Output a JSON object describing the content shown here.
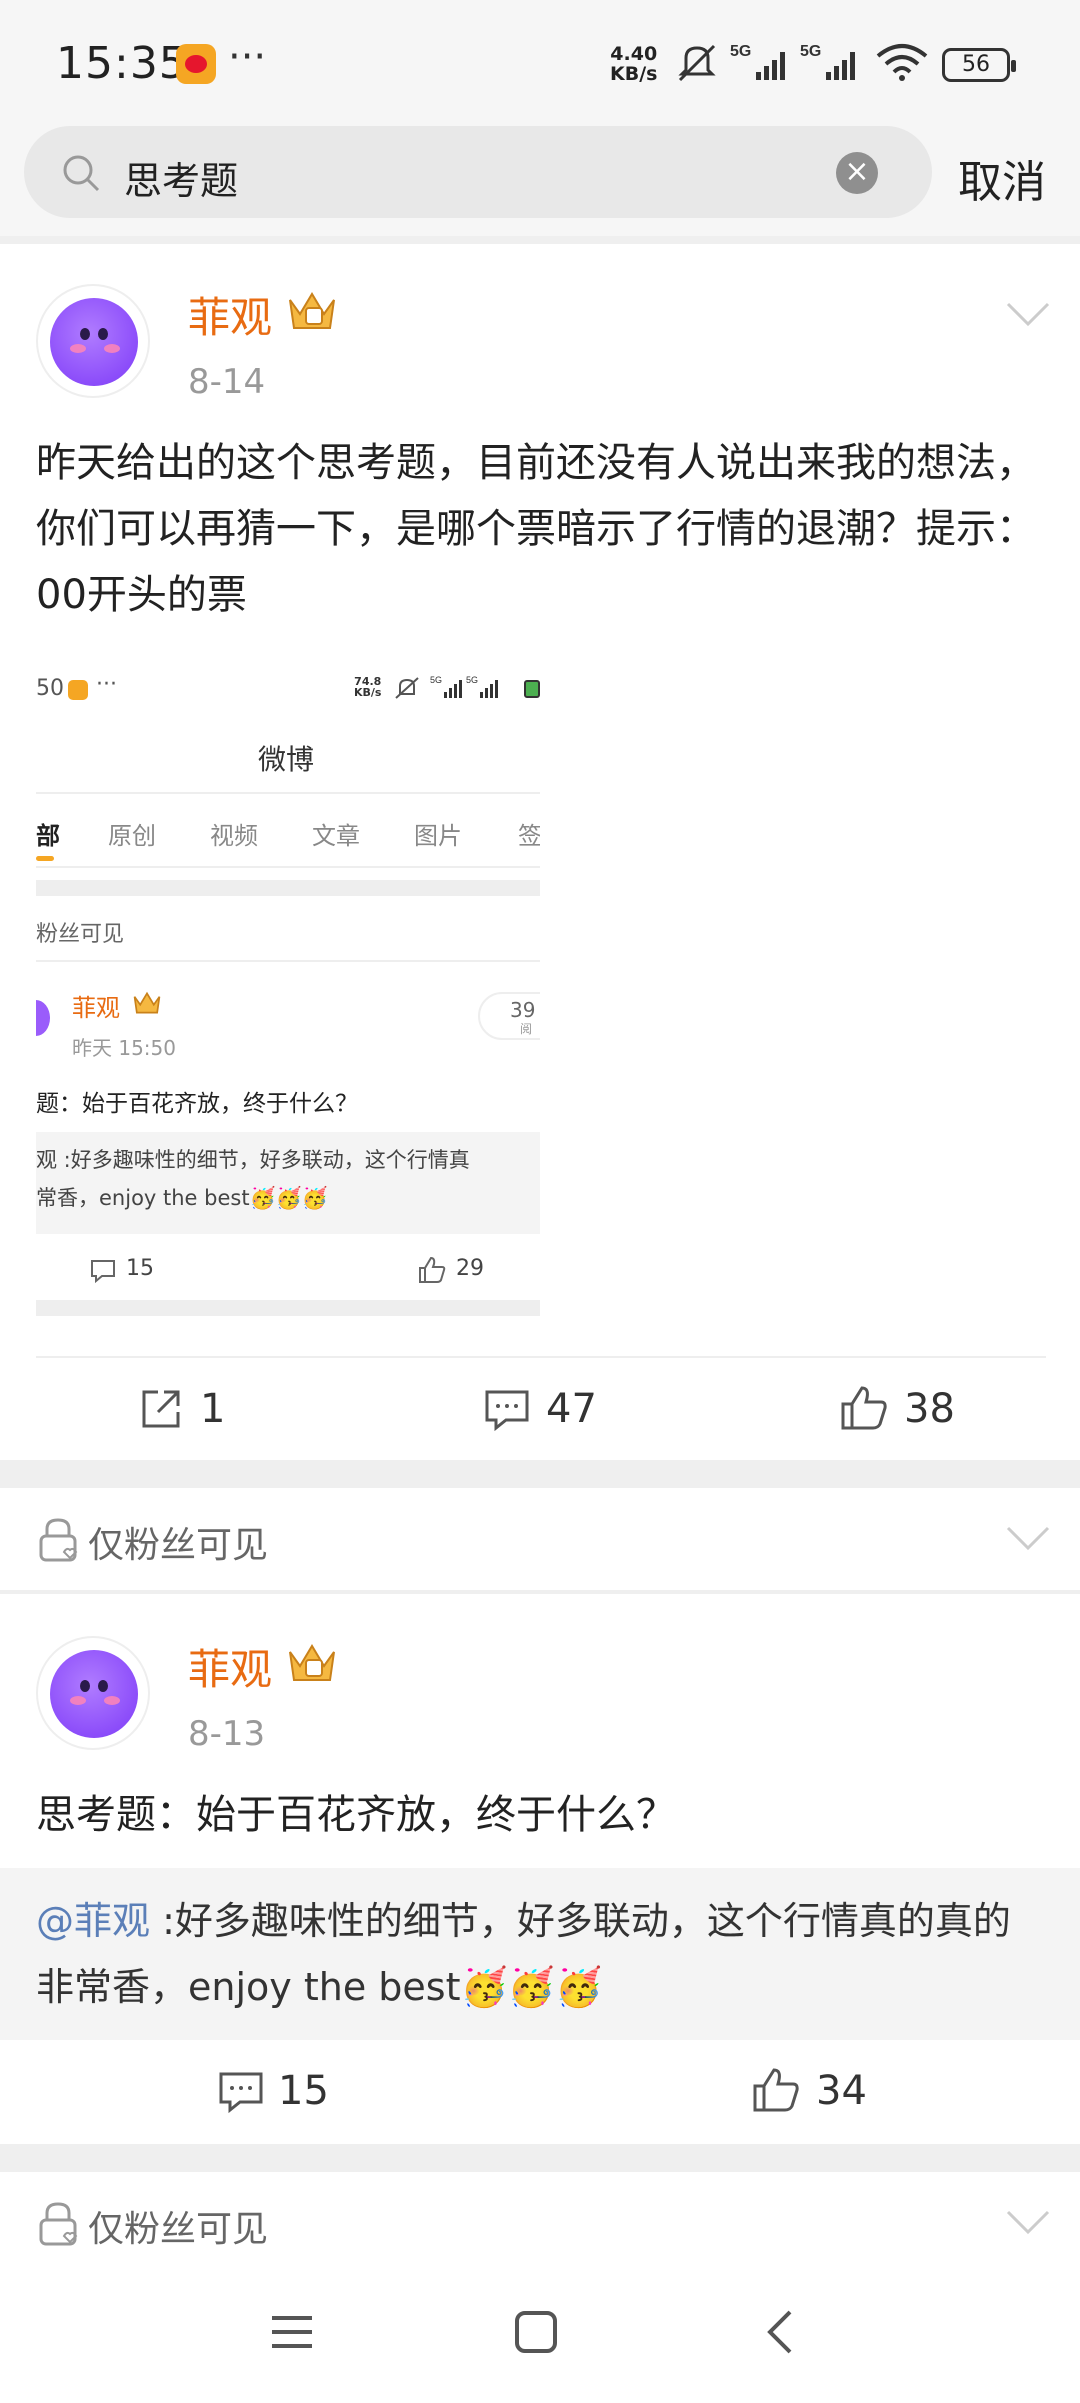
{
  "status": {
    "time": "15:35",
    "dots": "···",
    "speed_value": "4.40",
    "speed_unit": "KB/s",
    "net1": "5G",
    "net2": "5G",
    "battery": "56"
  },
  "search": {
    "query": "思考题",
    "cancel_label": "取消"
  },
  "posts": [
    {
      "author": "菲观",
      "date": "8-14",
      "text": "昨天给出的这个思考题，目前还没有人说出来我的想法，你们可以再猜一下，是哪个票暗示了行情的退潮？提示：00开头的票",
      "repost_count": "1",
      "comment_count": "47",
      "like_count": "38"
    },
    {
      "author": "菲观",
      "date": "8-13",
      "text": "思考题：始于百花齐放，终于什么？",
      "quote_mention": "@菲观",
      "quote_text": " :好多趣味性的细节，好多联动，这个行情真的真的非常香，enjoy the best🥳🥳🥳",
      "comment_count": "15",
      "like_count": "34"
    }
  ],
  "embedded": {
    "time_partial": "50",
    "dots": "···",
    "speed_value": "74.8",
    "speed_unit": "KB/s",
    "net1": "5G",
    "net2": "5G",
    "title": "微博",
    "tabs": [
      "部",
      "原创",
      "视频",
      "文章",
      "图片",
      "签"
    ],
    "fans_only": "粉丝可见",
    "author": "菲观",
    "time": "昨天 15:50",
    "read_count": "39",
    "read_label": "阅",
    "post_text": "题：始于百花齐放，终于什么？",
    "quote_line1": "观 :好多趣味性的细节，好多联动，这个行情真",
    "quote_line2": "常香，enjoy the best🥳🥳🥳",
    "comment_count": "15",
    "like_count": "29"
  },
  "fans_only_label": "仅粉丝可见",
  "colors": {
    "author": "#e86b12",
    "mention": "#5b7fb8",
    "embedded_tab_indicator": "#f5a623"
  }
}
